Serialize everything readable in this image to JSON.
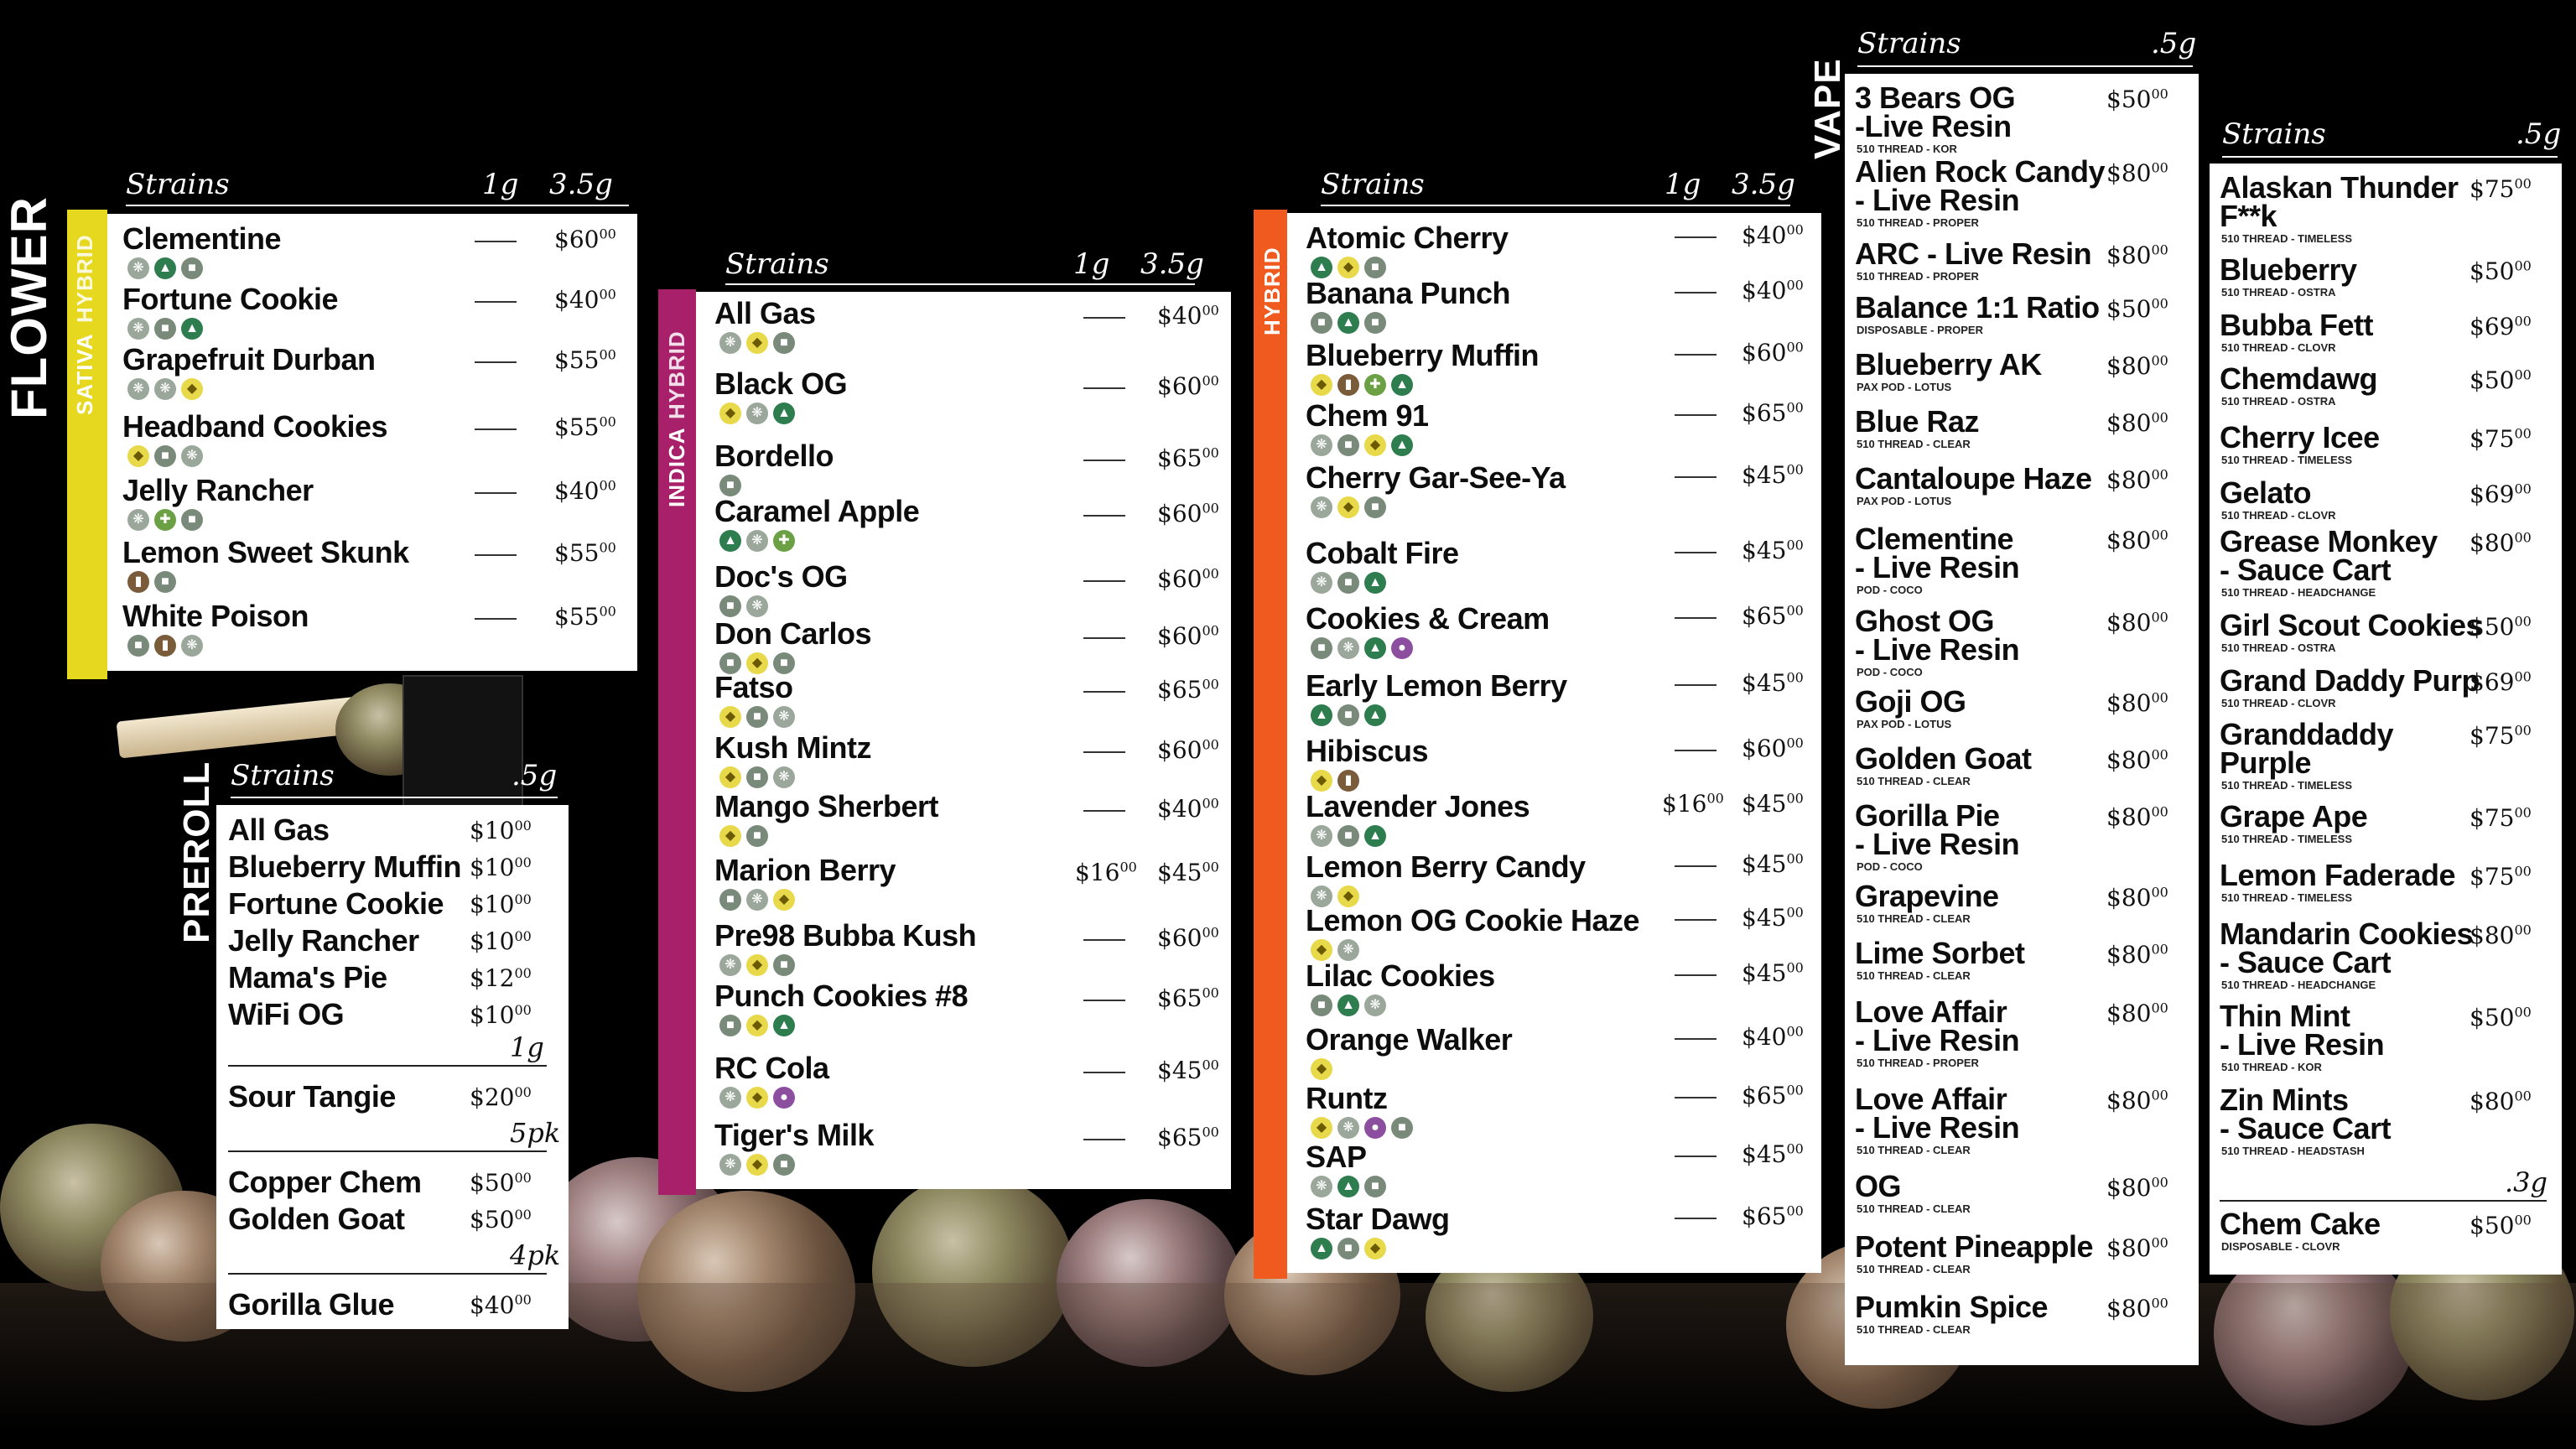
{
  "flower": {
    "section_label": "FLOWER",
    "sativa": {
      "labels": [
        "SATIVA",
        "HYBRID"
      ],
      "header": {
        "strains": "Strains",
        "col1": "1g",
        "col2": "3.5g"
      },
      "items": [
        {
          "name": "Clementine",
          "price": "$60",
          "cents": "00",
          "icons": [
            "hybrid",
            "tree",
            "sat"
          ]
        },
        {
          "name": "Fortune Cookie",
          "price": "$40",
          "cents": "00",
          "icons": [
            "hybrid",
            "sat",
            "tree"
          ]
        },
        {
          "name": "Grapefruit Durban",
          "price": "$55",
          "cents": "00",
          "icons": [
            "hybrid",
            "hybrid",
            "lemon"
          ]
        },
        {
          "name": "Headband Cookies",
          "price": "$55",
          "cents": "00",
          "icons": [
            "lemon",
            "sat",
            "hybrid"
          ]
        },
        {
          "name": "Jelly Rancher",
          "price": "$40",
          "cents": "00",
          "icons": [
            "hybrid",
            "leaf",
            "sat"
          ]
        },
        {
          "name": "Lemon Sweet Skunk",
          "price": "$55",
          "cents": "00",
          "icons": [
            "pot",
            "sat"
          ]
        },
        {
          "name": "White Poison",
          "price": "$55",
          "cents": "00",
          "icons": [
            "sat",
            "pot",
            "hybrid"
          ]
        }
      ]
    },
    "indica": {
      "labels": [
        "INDICA",
        "HYBRID"
      ],
      "header": {
        "strains": "Strains",
        "col1": "1g",
        "col2": "3.5g"
      },
      "items": [
        {
          "name": "All Gas",
          "p1": "",
          "price": "$40",
          "cents": "00",
          "icons": [
            "hybrid",
            "lemon",
            "sat"
          ]
        },
        {
          "name": "Black OG",
          "p1": "",
          "price": "$60",
          "cents": "00",
          "icons": [
            "lemon",
            "hybrid",
            "tree"
          ]
        },
        {
          "name": "Bordello",
          "p1": "",
          "price": "$65",
          "cents": "00",
          "icons": [
            "sat"
          ]
        },
        {
          "name": "Caramel Apple",
          "p1": "",
          "price": "$60",
          "cents": "00",
          "icons": [
            "tree",
            "hybrid",
            "leaf"
          ]
        },
        {
          "name": "Doc's OG",
          "p1": "",
          "price": "$60",
          "cents": "00",
          "icons": [
            "sat",
            "hybrid"
          ]
        },
        {
          "name": "Don Carlos",
          "p1": "",
          "price": "$60",
          "cents": "00",
          "icons": [
            "sat",
            "lemon",
            "sat"
          ]
        },
        {
          "name": "Fatso",
          "p1": "",
          "price": "$65",
          "cents": "00",
          "icons": [
            "lemon",
            "sat",
            "hybrid"
          ]
        },
        {
          "name": "Kush Mintz",
          "p1": "",
          "price": "$60",
          "cents": "00",
          "icons": [
            "lemon",
            "sat",
            "hybrid"
          ]
        },
        {
          "name": "Mango Sherbert",
          "p1": "",
          "price": "$40",
          "cents": "00",
          "icons": [
            "lemon",
            "sat"
          ]
        },
        {
          "name": "Marion Berry",
          "p1": "$16",
          "p1c": "00",
          "price": "$45",
          "cents": "00",
          "icons": [
            "sat",
            "hybrid",
            "lemon"
          ]
        },
        {
          "name": "Pre98 Bubba Kush",
          "p1": "",
          "price": "$60",
          "cents": "00",
          "icons": [
            "hybrid",
            "lemon",
            "sat"
          ]
        },
        {
          "name": "Punch Cookies #8",
          "p1": "",
          "price": "$65",
          "cents": "00",
          "icons": [
            "sat",
            "lemon",
            "tree"
          ]
        },
        {
          "name": "RC Cola",
          "p1": "",
          "price": "$45",
          "cents": "00",
          "icons": [
            "hybrid",
            "lemon",
            "grape"
          ]
        },
        {
          "name": "Tiger's Milk",
          "p1": "",
          "price": "$65",
          "cents": "00",
          "icons": [
            "hybrid",
            "lemon",
            "sat"
          ]
        }
      ]
    },
    "hybrid": {
      "label": "HYBRID",
      "header": {
        "strains": "Strains",
        "col1": "1g",
        "col2": "3.5g"
      },
      "items": [
        {
          "name": "Atomic Cherry",
          "p1": "",
          "price": "$40",
          "cents": "00",
          "icons": [
            "tree",
            "lemon",
            "sat"
          ]
        },
        {
          "name": "Banana Punch",
          "p1": "",
          "price": "$40",
          "cents": "00",
          "icons": [
            "sat",
            "tree",
            "sat"
          ]
        },
        {
          "name": "Blueberry Muffin",
          "p1": "",
          "price": "$60",
          "cents": "00",
          "icons": [
            "lemon",
            "pot",
            "leaf",
            "tree"
          ]
        },
        {
          "name": "Chem 91",
          "p1": "",
          "price": "$65",
          "cents": "00",
          "icons": [
            "hybrid",
            "sat",
            "lemon",
            "tree"
          ]
        },
        {
          "name": "Cherry Gar-See-Ya",
          "p1": "",
          "price": "$45",
          "cents": "00",
          "icons": [
            "hybrid",
            "lemon",
            "sat"
          ]
        },
        {
          "name": "Cobalt Fire",
          "p1": "",
          "price": "$45",
          "cents": "00",
          "icons": [
            "hybrid",
            "sat",
            "tree"
          ]
        },
        {
          "name": "Cookies & Cream",
          "p1": "",
          "price": "$65",
          "cents": "00",
          "icons": [
            "sat",
            "hybrid",
            "tree",
            "grape"
          ]
        },
        {
          "name": "Early Lemon Berry",
          "p1": "",
          "price": "$45",
          "cents": "00",
          "icons": [
            "tree",
            "sat",
            "tree"
          ]
        },
        {
          "name": "Hibiscus",
          "p1": "",
          "price": "$60",
          "cents": "00",
          "icons": [
            "lemon",
            "pot"
          ]
        },
        {
          "name": "Lavender Jones",
          "p1": "$16",
          "p1c": "00",
          "price": "$45",
          "cents": "00",
          "icons": [
            "hybrid",
            "sat",
            "tree"
          ]
        },
        {
          "name": "Lemon Berry Candy",
          "p1": "",
          "price": "$45",
          "cents": "00",
          "icons": [
            "hybrid",
            "lemon"
          ]
        },
        {
          "name": "Lemon OG Cookie Haze",
          "p1": "",
          "price": "$45",
          "cents": "00",
          "icons": [
            "lemon",
            "hybrid"
          ]
        },
        {
          "name": "Lilac Cookies",
          "p1": "",
          "price": "$45",
          "cents": "00",
          "icons": [
            "sat",
            "tree",
            "hybrid"
          ]
        },
        {
          "name": "Orange Walker",
          "p1": "",
          "price": "$40",
          "cents": "00",
          "icons": [
            "lemon"
          ]
        },
        {
          "name": "Runtz",
          "p1": "",
          "price": "$65",
          "cents": "00",
          "icons": [
            "lemon",
            "hybrid",
            "grape",
            "sat"
          ]
        },
        {
          "name": "SAP",
          "p1": "",
          "price": "$45",
          "cents": "00",
          "icons": [
            "hybrid",
            "tree",
            "sat"
          ]
        },
        {
          "name": "Star Dawg",
          "p1": "",
          "price": "$65",
          "cents": "00",
          "icons": [
            "tree",
            "sat",
            "lemon"
          ]
        }
      ]
    }
  },
  "preroll": {
    "section_label": "PREROLL",
    "header": {
      "strains": "Strains",
      "col": ".5g"
    },
    "items": [
      {
        "name": "All Gas",
        "price": "$10",
        "cents": "00"
      },
      {
        "name": "Blueberry Muffin",
        "price": "$10",
        "cents": "00"
      },
      {
        "name": "Fortune Cookie",
        "price": "$10",
        "cents": "00"
      },
      {
        "name": "Jelly Rancher",
        "price": "$10",
        "cents": "00"
      },
      {
        "name": "Mama's Pie",
        "price": "$12",
        "cents": "00"
      },
      {
        "name": "WiFi OG",
        "price": "$10",
        "cents": "00"
      }
    ],
    "g1": {
      "label": "1g",
      "items": [
        {
          "name": "Sour Tangie",
          "price": "$20",
          "cents": "00"
        }
      ]
    },
    "pk5": {
      "label": "5pk",
      "items": [
        {
          "name": "Copper Chem",
          "price": "$50",
          "cents": "00"
        },
        {
          "name": "Golden Goat",
          "price": "$50",
          "cents": "00"
        }
      ]
    },
    "pk4": {
      "label": "4pk",
      "items": [
        {
          "name": "Gorilla Glue",
          "price": "$40",
          "cents": "00"
        }
      ]
    }
  },
  "vape": {
    "section_label": "VAPE",
    "col1": {
      "header": {
        "strains": "Strains",
        "col": ".5g"
      },
      "items": [
        {
          "name": "3 Bears OG\n-Live Resin",
          "sub": "510 THREAD - KOR",
          "price": "$50",
          "cents": "00"
        },
        {
          "name": "Alien Rock Candy\n- Live Resin",
          "sub": "510 THREAD - PROPER",
          "price": "$80",
          "cents": "00"
        },
        {
          "name": "ARC - Live Resin",
          "sub": "510 THREAD - PROPER",
          "price": "$80",
          "cents": "00"
        },
        {
          "name": "Balance 1:1 Ratio",
          "sub": "DISPOSABLE - PROPER",
          "price": "$50",
          "cents": "00"
        },
        {
          "name": "Blueberry AK",
          "sub": "PAX POD - LOTUS",
          "price": "$80",
          "cents": "00"
        },
        {
          "name": "Blue Raz",
          "sub": "510 THREAD - CLEAR",
          "price": "$80",
          "cents": "00"
        },
        {
          "name": "Cantaloupe Haze",
          "sub": "PAX POD - LOTUS",
          "price": "$80",
          "cents": "00"
        },
        {
          "name": "Clementine\n- Live Resin",
          "sub": "POD - COCO",
          "price": "$80",
          "cents": "00"
        },
        {
          "name": "Ghost OG\n- Live Resin",
          "sub": "POD - COCO",
          "price": "$80",
          "cents": "00"
        },
        {
          "name": "Goji OG",
          "sub": "PAX POD - LOTUS",
          "price": "$80",
          "cents": "00"
        },
        {
          "name": "Golden Goat",
          "sub": "510 THREAD - CLEAR",
          "price": "$80",
          "cents": "00"
        },
        {
          "name": "Gorilla Pie\n- Live Resin",
          "sub": "POD - COCO",
          "price": "$80",
          "cents": "00"
        },
        {
          "name": "Grapevine",
          "sub": "510 THREAD - CLEAR",
          "price": "$80",
          "cents": "00"
        },
        {
          "name": "Lime Sorbet",
          "sub": "510 THREAD - CLEAR",
          "price": "$80",
          "cents": "00"
        },
        {
          "name": "Love Affair\n- Live Resin",
          "sub": "510 THREAD - PROPER",
          "price": "$80",
          "cents": "00"
        },
        {
          "name": "Love Affair\n- Live Resin",
          "sub": "510 THREAD - CLEAR",
          "price": "$80",
          "cents": "00"
        },
        {
          "name": "OG",
          "sub": "510 THREAD - CLEAR",
          "price": "$80",
          "cents": "00"
        },
        {
          "name": "Potent Pineapple",
          "sub": "510 THREAD - CLEAR",
          "price": "$80",
          "cents": "00"
        },
        {
          "name": "Pumkin Spice",
          "sub": "510 THREAD - CLEAR",
          "price": "$80",
          "cents": "00"
        }
      ]
    },
    "col2": {
      "header": {
        "strains": "Strains",
        "col": ".5g"
      },
      "items": [
        {
          "name": "Alaskan Thunder\nF**k",
          "sub": "510 THREAD - TIMELESS",
          "price": "$75",
          "cents": "00"
        },
        {
          "name": "Blueberry",
          "sub": "510 THREAD - OSTRA",
          "price": "$50",
          "cents": "00"
        },
        {
          "name": "Bubba Fett",
          "sub": "510 THREAD - CLOVR",
          "price": "$69",
          "cents": "00"
        },
        {
          "name": "Chemdawg",
          "sub": "510 THREAD - OSTRA",
          "price": "$50",
          "cents": "00"
        },
        {
          "name": "Cherry Icee",
          "sub": "510 THREAD - TIMELESS",
          "price": "$75",
          "cents": "00"
        },
        {
          "name": "Gelato",
          "sub": "510 THREAD - CLOVR",
          "price": "$69",
          "cents": "00"
        },
        {
          "name": "Grease Monkey\n- Sauce Cart",
          "sub": "510 THREAD - HEADCHANGE",
          "price": "$80",
          "cents": "00"
        },
        {
          "name": "Girl Scout Cookies",
          "sub": "510 THREAD - OSTRA",
          "price": "$50",
          "cents": "00"
        },
        {
          "name": "Grand Daddy Purp",
          "sub": "510 THREAD - CLOVR",
          "price": "$69",
          "cents": "00"
        },
        {
          "name": "Granddaddy\nPurple",
          "sub": "510 THREAD - TIMELESS",
          "price": "$75",
          "cents": "00"
        },
        {
          "name": "Grape Ape",
          "sub": "510 THREAD - TIMELESS",
          "price": "$75",
          "cents": "00"
        },
        {
          "name": "Lemon Faderade",
          "sub": "510 THREAD - TIMELESS",
          "price": "$75",
          "cents": "00"
        },
        {
          "name": "Mandarin Cookies\n- Sauce Cart",
          "sub": "510 THREAD - HEADCHANGE",
          "price": "$80",
          "cents": "00"
        },
        {
          "name": "Thin Mint\n- Live Resin",
          "sub": "510 THREAD - KOR",
          "price": "$50",
          "cents": "00"
        },
        {
          "name": "Zin Mints\n- Sauce Cart",
          "sub": "510 THREAD - HEADSTASH",
          "price": "$80",
          "cents": "00"
        }
      ],
      "g3": {
        "label": ".3g",
        "items": [
          {
            "name": "Chem Cake",
            "sub": "DISPOSABLE - CLOVR",
            "price": "$50",
            "cents": "00"
          }
        ]
      }
    }
  },
  "colors": {
    "sativa": "#e6d81f",
    "indica": "#a8206a",
    "hybrid": "#f05a1e",
    "background": "#000000"
  }
}
